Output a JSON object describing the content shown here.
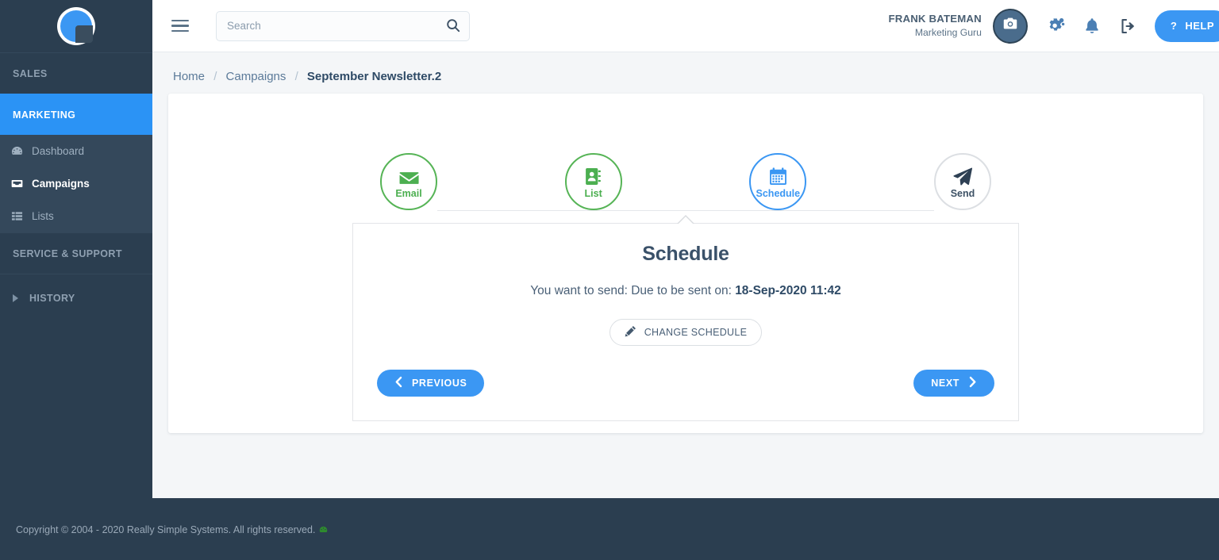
{
  "sidebar": {
    "logo_name": "really-simple-systems-logo",
    "sections": [
      {
        "label": "SALES",
        "active": false
      },
      {
        "label": "MARKETING",
        "active": true
      },
      {
        "label": "SERVICE & SUPPORT",
        "active": false
      }
    ],
    "marketing_items": [
      {
        "label": "Dashboard",
        "icon": "dashboard-icon",
        "current": false
      },
      {
        "label": "Campaigns",
        "icon": "inbox-icon",
        "current": true
      },
      {
        "label": "Lists",
        "icon": "list-icon",
        "current": false
      }
    ],
    "history_label": "HISTORY"
  },
  "topbar": {
    "menu_icon": "hamburger-icon",
    "search": {
      "value": "",
      "placeholder": "Search",
      "icon": "search-icon"
    },
    "user": {
      "name": "FRANK BATEMAN",
      "role": "Marketing Guru",
      "avatar_icon": "camera-icon"
    },
    "icons": [
      {
        "name": "settings-gear-icon"
      },
      {
        "name": "notification-bell-icon"
      },
      {
        "name": "logout-icon"
      }
    ],
    "help": {
      "label": "HELP",
      "icon": "question-mark-icon"
    }
  },
  "breadcrumb": {
    "home": "Home",
    "campaigns": "Campaigns",
    "current": "September Newsletter.2",
    "separator": "/"
  },
  "steps": [
    {
      "label": "Email",
      "icon": "envelope-icon",
      "state": "done"
    },
    {
      "label": "List",
      "icon": "address-book-icon",
      "state": "done"
    },
    {
      "label": "Schedule",
      "icon": "calendar-icon",
      "state": "active"
    },
    {
      "label": "Send",
      "icon": "paper-plane-icon",
      "state": "todo"
    }
  ],
  "card": {
    "title": "Schedule",
    "subtitle_prefix": "You want to send: Due to be sent on:",
    "schedule_value": "18-Sep-2020 11:42",
    "change_button": {
      "label": "CHANGE SCHEDULE",
      "icon": "pencil-icon"
    },
    "previous_button": {
      "label": "PREVIOUS",
      "icon": "chevron-left-icon"
    },
    "next_button": {
      "label": "NEXT",
      "icon": "chevron-right-icon"
    }
  },
  "footer": {
    "copyright": "Copyright © 2004 - 2020 Really Simple Systems. All rights reserved.",
    "badge_icon": "green-leaf-icon"
  },
  "colors": {
    "sidebar_bg": "#2b3e50",
    "submenu_bg": "#34485b",
    "accent_blue": "#3b97f3",
    "active_blue": "#2b93f5",
    "done_green": "#4caf50",
    "page_bg": "#f4f6f8",
    "text_dark": "#3e5266"
  }
}
